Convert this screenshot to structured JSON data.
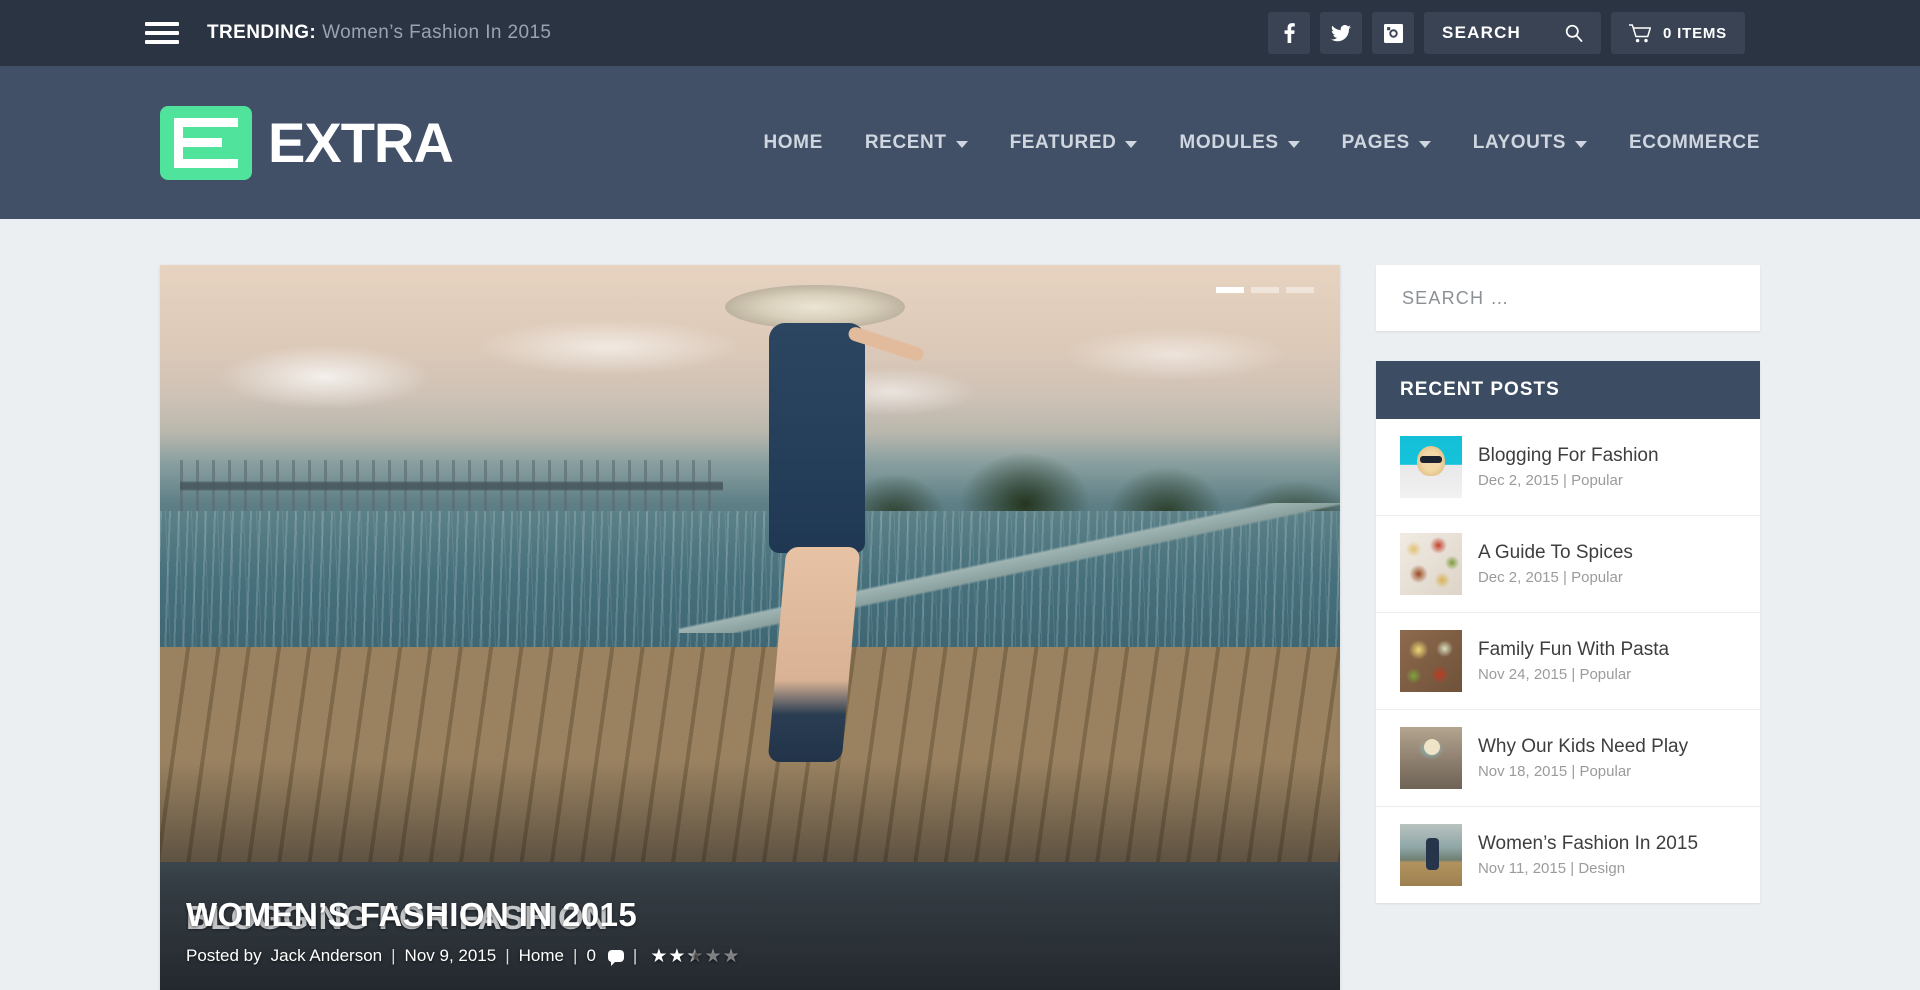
{
  "topbar": {
    "menu_icon": "hamburger-icon",
    "trending_label": "TRENDING:",
    "trending_headline": "Women’s Fashion In 2015",
    "social": [
      {
        "name": "facebook-icon",
        "label": "f"
      },
      {
        "name": "twitter-icon",
        "label": "t"
      },
      {
        "name": "instagram-icon",
        "label": "ig"
      }
    ],
    "search_label": "SEARCH",
    "search_icon": "magnifier-icon",
    "cart_icon": "shopping-cart-icon",
    "cart_label": "0 ITEMS"
  },
  "brand": {
    "logo_icon": "extra-logo-mark",
    "name": "EXTRA"
  },
  "nav": {
    "items": [
      {
        "label": "HOME",
        "has_dropdown": false
      },
      {
        "label": "RECENT",
        "has_dropdown": true
      },
      {
        "label": "FEATURED",
        "has_dropdown": true
      },
      {
        "label": "MODULES",
        "has_dropdown": true
      },
      {
        "label": "PAGES",
        "has_dropdown": true
      },
      {
        "label": "LAYOUTS",
        "has_dropdown": true
      },
      {
        "label": "ECOMMERCE",
        "has_dropdown": false
      }
    ]
  },
  "hero": {
    "title": "WOMEN’S FASHION IN 2015",
    "ghost_title": "BLOGGING FOR FASHION",
    "posted_by_label": "Posted by",
    "author": "Jack Anderson",
    "date": "Nov 9, 2015",
    "category": "Home",
    "comment_count": "0",
    "comment_icon": "comment-bubble-icon",
    "rating": 2.5,
    "rating_max": 5,
    "pager": [
      {
        "active": true
      },
      {
        "active": false
      },
      {
        "active": false
      }
    ]
  },
  "sidebar": {
    "search_placeholder": "SEARCH …",
    "recent_posts": {
      "heading": "RECENT POSTS",
      "items": [
        {
          "title": "Blogging For Fashion",
          "date": "Dec 2, 2015",
          "separator": "|",
          "category": "Popular",
          "thumb": "fashion-model-thumb"
        },
        {
          "title": "A Guide To Spices",
          "date": "Dec 2, 2015",
          "separator": "|",
          "category": "Popular",
          "thumb": "spices-thumb"
        },
        {
          "title": "Family Fun With Pasta",
          "date": "Nov 24, 2015",
          "separator": "|",
          "category": "Popular",
          "thumb": "pasta-thumb"
        },
        {
          "title": "Why Our Kids Need Play",
          "date": "Nov 18, 2015",
          "separator": "|",
          "category": "Popular",
          "thumb": "kids-play-thumb"
        },
        {
          "title": "Women’s Fashion In 2015",
          "date": "Nov 11, 2015",
          "separator": "|",
          "category": "Design",
          "thumb": "womens-fashion-thumb"
        }
      ]
    }
  },
  "colors": {
    "topbar_bg": "#2b3443",
    "navbar_bg": "#415066",
    "page_bg": "#eceff1",
    "logo_green": "#4fe39b",
    "widget_head_bg": "#3c4d63",
    "nav_text": "#cfd6e0"
  }
}
